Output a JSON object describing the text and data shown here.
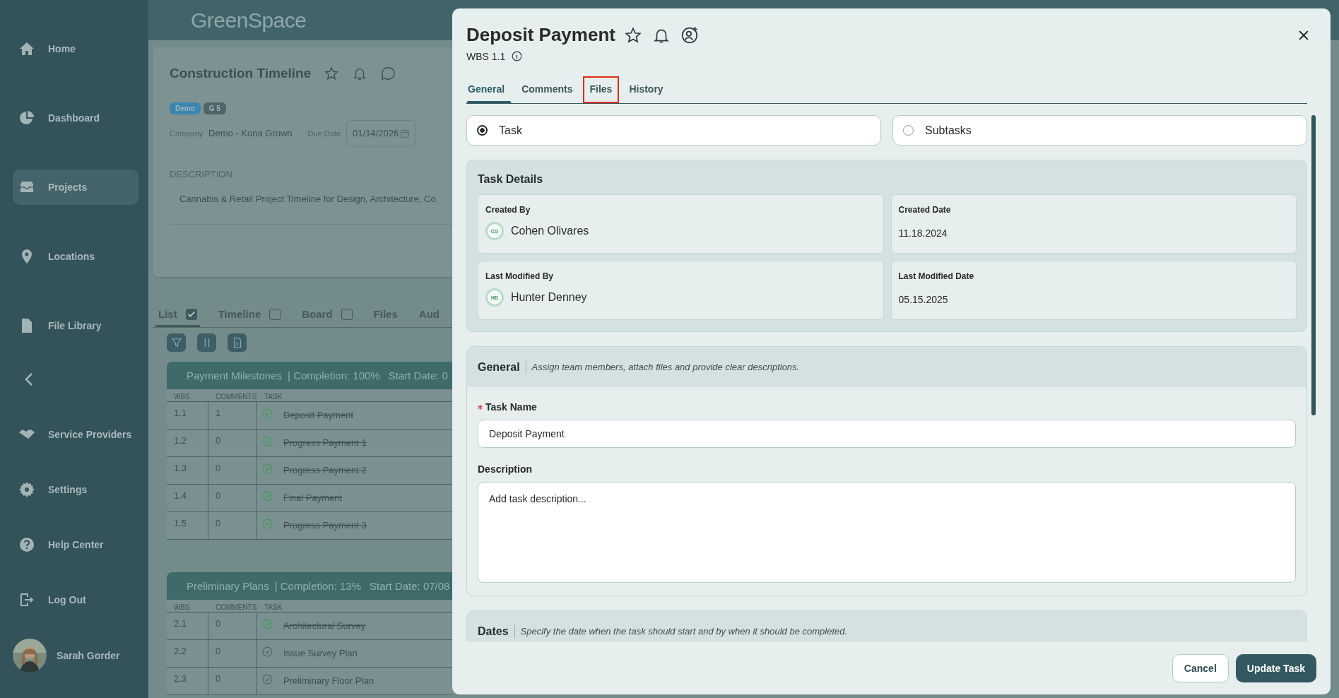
{
  "sidebar": {
    "nav": [
      {
        "label": "Home",
        "selected": false
      },
      {
        "label": "Dashboard",
        "selected": false
      },
      {
        "label": "Projects",
        "selected": true
      },
      {
        "label": "Locations",
        "selected": false
      },
      {
        "label": "File Library",
        "selected": false
      }
    ],
    "more": [
      {
        "label": "Service Providers",
        "selected": false
      },
      {
        "label": "Settings",
        "selected": false
      },
      {
        "label": "Help Center",
        "selected": false
      },
      {
        "label": "Log Out",
        "selected": false
      }
    ],
    "user": {
      "name": "Sarah Gorder"
    }
  },
  "header": {
    "logo": "GreenSpace"
  },
  "project": {
    "title": "Construction Timeline",
    "tags": [
      {
        "label": "Demo",
        "color": "#3b86b0"
      },
      {
        "label": "G 5",
        "color": "#4f6467"
      }
    ],
    "company_label": "Company",
    "company": "Demo - Kona Grown",
    "due_label": "Due Date",
    "due_date": "01/14/2026",
    "description_label": "DESCRIPTION",
    "description": "Cannabis & Retail Project Timeline for Design, Architecture, Co"
  },
  "view_tabs": [
    {
      "label": "List",
      "selected": true,
      "checked": true
    },
    {
      "label": "Timeline",
      "selected": false,
      "checked": false
    },
    {
      "label": "Board",
      "selected": false,
      "checked": false
    },
    {
      "label": "Files",
      "selected": false
    },
    {
      "label": "Aud",
      "selected": false
    }
  ],
  "groups": [
    {
      "title": "Payment Milestones",
      "completion": "| Completion: 100%",
      "start": "Start Date: 0",
      "columns": [
        "WBS",
        "COMMENTS",
        "TASK"
      ],
      "rows": [
        {
          "wbs": "1.1",
          "comments": "1",
          "task": "Deposit Payment",
          "done": true
        },
        {
          "wbs": "1.2",
          "comments": "0",
          "task": "Progress Payment 1",
          "done": true
        },
        {
          "wbs": "1.3",
          "comments": "0",
          "task": "Progress Payment 2",
          "done": true
        },
        {
          "wbs": "1.4",
          "comments": "0",
          "task": "Final Payment",
          "done": true
        },
        {
          "wbs": "1.5",
          "comments": "0",
          "task": "Progress Payment 3",
          "done": true
        }
      ]
    },
    {
      "title": "Preliminary Plans",
      "completion": "| Completion: 13%",
      "start": "Start Date: 07/08",
      "columns": [
        "WBS",
        "COMMENTS",
        "TASK"
      ],
      "rows": [
        {
          "wbs": "2.1",
          "comments": "0",
          "task": "Architectural Survey",
          "done": true
        },
        {
          "wbs": "2.2",
          "comments": "0",
          "task": "Issue Survey Plan",
          "done": false
        },
        {
          "wbs": "2.3",
          "comments": "0",
          "task": "Preliminary Floor Plan",
          "done": false
        }
      ]
    }
  ],
  "modal": {
    "title": "Deposit Payment",
    "wbs": "WBS 1.1",
    "tabs": [
      {
        "label": "General",
        "selected": true,
        "highlighted": false
      },
      {
        "label": "Comments",
        "selected": false,
        "highlighted": false
      },
      {
        "label": "Files",
        "selected": false,
        "highlighted": true
      },
      {
        "label": "History",
        "selected": false,
        "highlighted": false
      }
    ],
    "modes": [
      {
        "label": "Task",
        "selected": true
      },
      {
        "label": "Subtasks",
        "selected": false
      }
    ],
    "task_details": {
      "title": "Task Details",
      "fields": [
        {
          "label": "Created By",
          "value": "Cohen Olivares",
          "initials": "CO"
        },
        {
          "label": "Created Date",
          "value": "11.18.2024"
        },
        {
          "label": "Last Modified By",
          "value": "Hunter Denney",
          "initials": "HD"
        },
        {
          "label": "Last Modified Date",
          "value": "05.15.2025"
        }
      ]
    },
    "general": {
      "title": "General",
      "hint": "Assign team members, attach files and provide clear descriptions.",
      "task_name_label": "Task Name",
      "task_name": "Deposit Payment",
      "description_label": "Description",
      "description_placeholder": "Add task description..."
    },
    "dates": {
      "title": "Dates",
      "hint": "Specify the date when the task should start and by when it should be completed."
    },
    "buttons": [
      {
        "label": "Cancel",
        "kind": "secondary"
      },
      {
        "label": "Update Task",
        "kind": "primary"
      }
    ]
  }
}
